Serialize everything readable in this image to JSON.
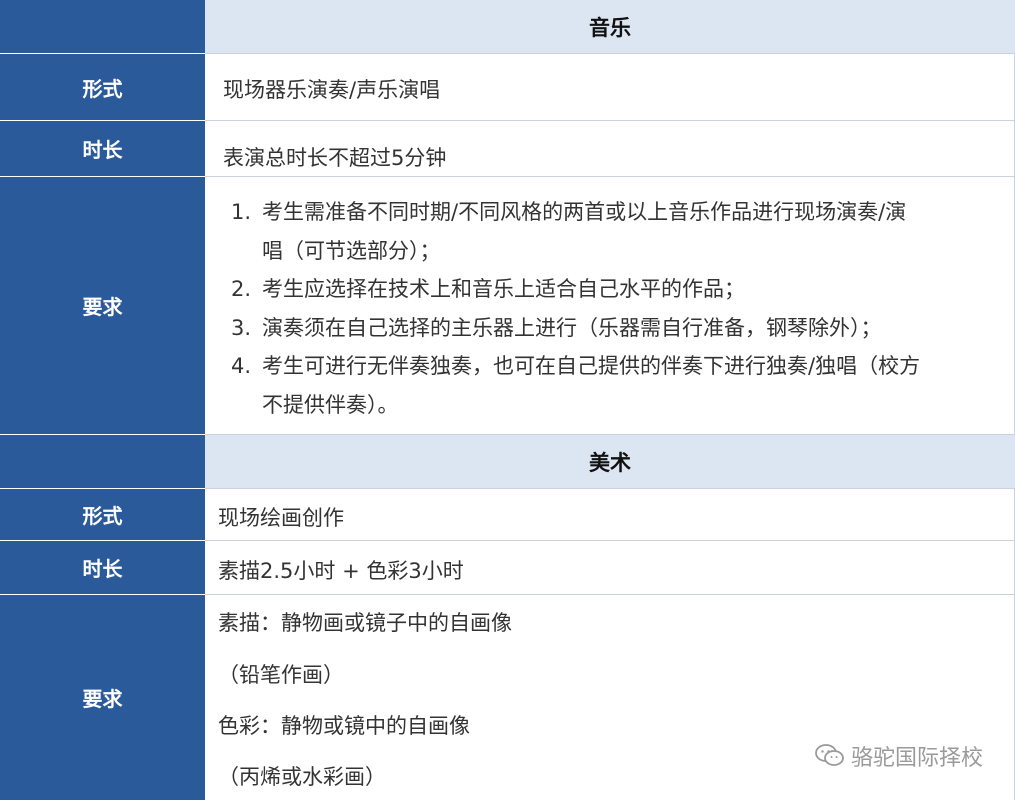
{
  "music": {
    "header": "音乐",
    "format_label": "形式",
    "format_value": "现场器乐演奏/声乐演唱",
    "duration_label": "时长",
    "duration_value": "表演总时长不超过5分钟",
    "requirements_label": "要求",
    "requirements": [
      {
        "num": "1.",
        "lines": [
          "考生需准备不同时期/不同风格的两首或以上音乐作品进行现场演奏/演",
          "唱（可节选部分）；"
        ]
      },
      {
        "num": "2.",
        "lines": [
          "考生应选择在技术上和音乐上适合自己水平的作品；"
        ]
      },
      {
        "num": "3.",
        "lines": [
          "演奏须在自己选择的主乐器上进行（乐器需自行准备，钢琴除外）；"
        ]
      },
      {
        "num": "4.",
        "lines": [
          "考生可进行无伴奏独奏，也可在自己提供的伴奏下进行独奏/独唱（校方",
          "不提供伴奏）。"
        ]
      }
    ]
  },
  "art": {
    "header": "美术",
    "format_label": "形式",
    "format_value": "现场绘画创作",
    "duration_label": "时长",
    "duration_value": "素描2.5小时 + 色彩3小时",
    "requirements_label": "要求",
    "requirements": [
      "素描：静物画或镜子中的自画像",
      "（铅笔作画）",
      "色彩：静物或镜中的自画像",
      "（丙烯或水彩画）"
    ]
  },
  "watermark": {
    "text": "骆驼国际择校",
    "icon": "wechat-icon"
  },
  "colors": {
    "label_bg": "#2b5a9a",
    "header_bg": "#dce6f2",
    "border": "#c9d3df"
  }
}
